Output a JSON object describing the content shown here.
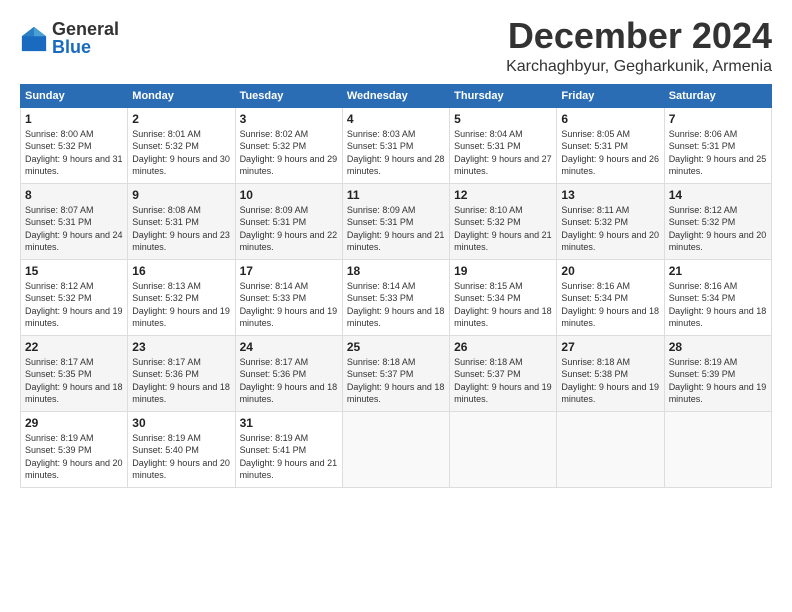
{
  "logo": {
    "general": "General",
    "blue": "Blue"
  },
  "header": {
    "month": "December 2024",
    "location": "Karchaghbyur, Gegharkunik, Armenia"
  },
  "weekdays": [
    "Sunday",
    "Monday",
    "Tuesday",
    "Wednesday",
    "Thursday",
    "Friday",
    "Saturday"
  ],
  "weeks": [
    [
      {
        "day": "1",
        "sunrise": "8:00 AM",
        "sunset": "5:32 PM",
        "daylight": "9 hours and 31 minutes."
      },
      {
        "day": "2",
        "sunrise": "8:01 AM",
        "sunset": "5:32 PM",
        "daylight": "9 hours and 30 minutes."
      },
      {
        "day": "3",
        "sunrise": "8:02 AM",
        "sunset": "5:32 PM",
        "daylight": "9 hours and 29 minutes."
      },
      {
        "day": "4",
        "sunrise": "8:03 AM",
        "sunset": "5:31 PM",
        "daylight": "9 hours and 28 minutes."
      },
      {
        "day": "5",
        "sunrise": "8:04 AM",
        "sunset": "5:31 PM",
        "daylight": "9 hours and 27 minutes."
      },
      {
        "day": "6",
        "sunrise": "8:05 AM",
        "sunset": "5:31 PM",
        "daylight": "9 hours and 26 minutes."
      },
      {
        "day": "7",
        "sunrise": "8:06 AM",
        "sunset": "5:31 PM",
        "daylight": "9 hours and 25 minutes."
      }
    ],
    [
      {
        "day": "8",
        "sunrise": "8:07 AM",
        "sunset": "5:31 PM",
        "daylight": "9 hours and 24 minutes."
      },
      {
        "day": "9",
        "sunrise": "8:08 AM",
        "sunset": "5:31 PM",
        "daylight": "9 hours and 23 minutes."
      },
      {
        "day": "10",
        "sunrise": "8:09 AM",
        "sunset": "5:31 PM",
        "daylight": "9 hours and 22 minutes."
      },
      {
        "day": "11",
        "sunrise": "8:09 AM",
        "sunset": "5:31 PM",
        "daylight": "9 hours and 21 minutes."
      },
      {
        "day": "12",
        "sunrise": "8:10 AM",
        "sunset": "5:32 PM",
        "daylight": "9 hours and 21 minutes."
      },
      {
        "day": "13",
        "sunrise": "8:11 AM",
        "sunset": "5:32 PM",
        "daylight": "9 hours and 20 minutes."
      },
      {
        "day": "14",
        "sunrise": "8:12 AM",
        "sunset": "5:32 PM",
        "daylight": "9 hours and 20 minutes."
      }
    ],
    [
      {
        "day": "15",
        "sunrise": "8:12 AM",
        "sunset": "5:32 PM",
        "daylight": "9 hours and 19 minutes."
      },
      {
        "day": "16",
        "sunrise": "8:13 AM",
        "sunset": "5:32 PM",
        "daylight": "9 hours and 19 minutes."
      },
      {
        "day": "17",
        "sunrise": "8:14 AM",
        "sunset": "5:33 PM",
        "daylight": "9 hours and 19 minutes."
      },
      {
        "day": "18",
        "sunrise": "8:14 AM",
        "sunset": "5:33 PM",
        "daylight": "9 hours and 18 minutes."
      },
      {
        "day": "19",
        "sunrise": "8:15 AM",
        "sunset": "5:34 PM",
        "daylight": "9 hours and 18 minutes."
      },
      {
        "day": "20",
        "sunrise": "8:16 AM",
        "sunset": "5:34 PM",
        "daylight": "9 hours and 18 minutes."
      },
      {
        "day": "21",
        "sunrise": "8:16 AM",
        "sunset": "5:34 PM",
        "daylight": "9 hours and 18 minutes."
      }
    ],
    [
      {
        "day": "22",
        "sunrise": "8:17 AM",
        "sunset": "5:35 PM",
        "daylight": "9 hours and 18 minutes."
      },
      {
        "day": "23",
        "sunrise": "8:17 AM",
        "sunset": "5:36 PM",
        "daylight": "9 hours and 18 minutes."
      },
      {
        "day": "24",
        "sunrise": "8:17 AM",
        "sunset": "5:36 PM",
        "daylight": "9 hours and 18 minutes."
      },
      {
        "day": "25",
        "sunrise": "8:18 AM",
        "sunset": "5:37 PM",
        "daylight": "9 hours and 18 minutes."
      },
      {
        "day": "26",
        "sunrise": "8:18 AM",
        "sunset": "5:37 PM",
        "daylight": "9 hours and 19 minutes."
      },
      {
        "day": "27",
        "sunrise": "8:18 AM",
        "sunset": "5:38 PM",
        "daylight": "9 hours and 19 minutes."
      },
      {
        "day": "28",
        "sunrise": "8:19 AM",
        "sunset": "5:39 PM",
        "daylight": "9 hours and 19 minutes."
      }
    ],
    [
      {
        "day": "29",
        "sunrise": "8:19 AM",
        "sunset": "5:39 PM",
        "daylight": "9 hours and 20 minutes."
      },
      {
        "day": "30",
        "sunrise": "8:19 AM",
        "sunset": "5:40 PM",
        "daylight": "9 hours and 20 minutes."
      },
      {
        "day": "31",
        "sunrise": "8:19 AM",
        "sunset": "5:41 PM",
        "daylight": "9 hours and 21 minutes."
      },
      null,
      null,
      null,
      null
    ]
  ]
}
